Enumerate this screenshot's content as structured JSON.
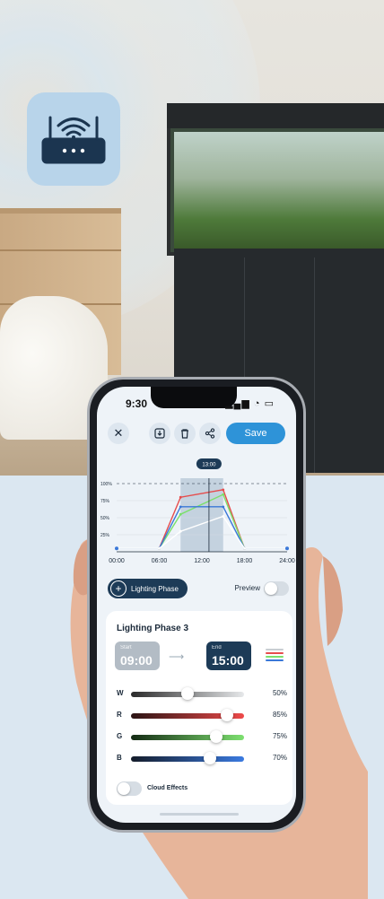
{
  "router_icon": "wifi-router-icon",
  "phone": {
    "status": {
      "time": "9:30",
      "icons": "signal-wifi-battery"
    },
    "toolbar": {
      "close_icon": "close-icon",
      "download_icon": "download-icon",
      "delete_icon": "trash-icon",
      "share_icon": "share-icon",
      "save_label": "Save"
    },
    "chart_data": {
      "type": "line",
      "x_ticks": [
        "00:00",
        "06:00",
        "12:00",
        "18:00",
        "24:00"
      ],
      "y_ticks": [
        "100%",
        "75%",
        "50%",
        "25%"
      ],
      "xlim": [
        0,
        24
      ],
      "ylim": [
        0,
        100
      ],
      "current_time_label": "13:00",
      "highlight_range": [
        9,
        15
      ],
      "series": [
        {
          "color": "#e64c4c",
          "x": [
            0,
            6,
            9,
            15,
            18,
            24
          ],
          "y": [
            5,
            5,
            80,
            91,
            5,
            5
          ]
        },
        {
          "color": "#7be06a",
          "x": [
            0,
            6,
            9,
            15,
            18,
            24
          ],
          "y": [
            5,
            5,
            55,
            84,
            5,
            5
          ]
        },
        {
          "color": "#3a78d8",
          "x": [
            0,
            6,
            9,
            15,
            18,
            24
          ],
          "y": [
            5,
            5,
            66,
            66,
            5,
            5
          ]
        },
        {
          "color": "#ffffff",
          "x": [
            0,
            6,
            9,
            15,
            18,
            24
          ],
          "y": [
            5,
            5,
            30,
            52,
            5,
            5
          ]
        }
      ]
    },
    "phase_button_label": "Lighting Phase",
    "preview_label": "Preview",
    "card": {
      "title": "Lighting Phase 3",
      "start_label": "Start",
      "start_time": "09:00",
      "end_label": "End",
      "end_time": "15:00",
      "sliders": [
        {
          "channel": "W",
          "value": 50,
          "pct": "50%",
          "color_from": "#2a2a2a",
          "color_to": "#e6e8ea"
        },
        {
          "channel": "R",
          "value": 85,
          "pct": "85%",
          "color_from": "#2a1414",
          "color_to": "#ee4a4a"
        },
        {
          "channel": "G",
          "value": 75,
          "pct": "75%",
          "color_from": "#142a14",
          "color_to": "#7de070"
        },
        {
          "channel": "B",
          "value": 70,
          "pct": "70%",
          "color_from": "#141c2a",
          "color_to": "#3a7ae0"
        }
      ],
      "cloud_effects_label": "Cloud Effects"
    }
  }
}
